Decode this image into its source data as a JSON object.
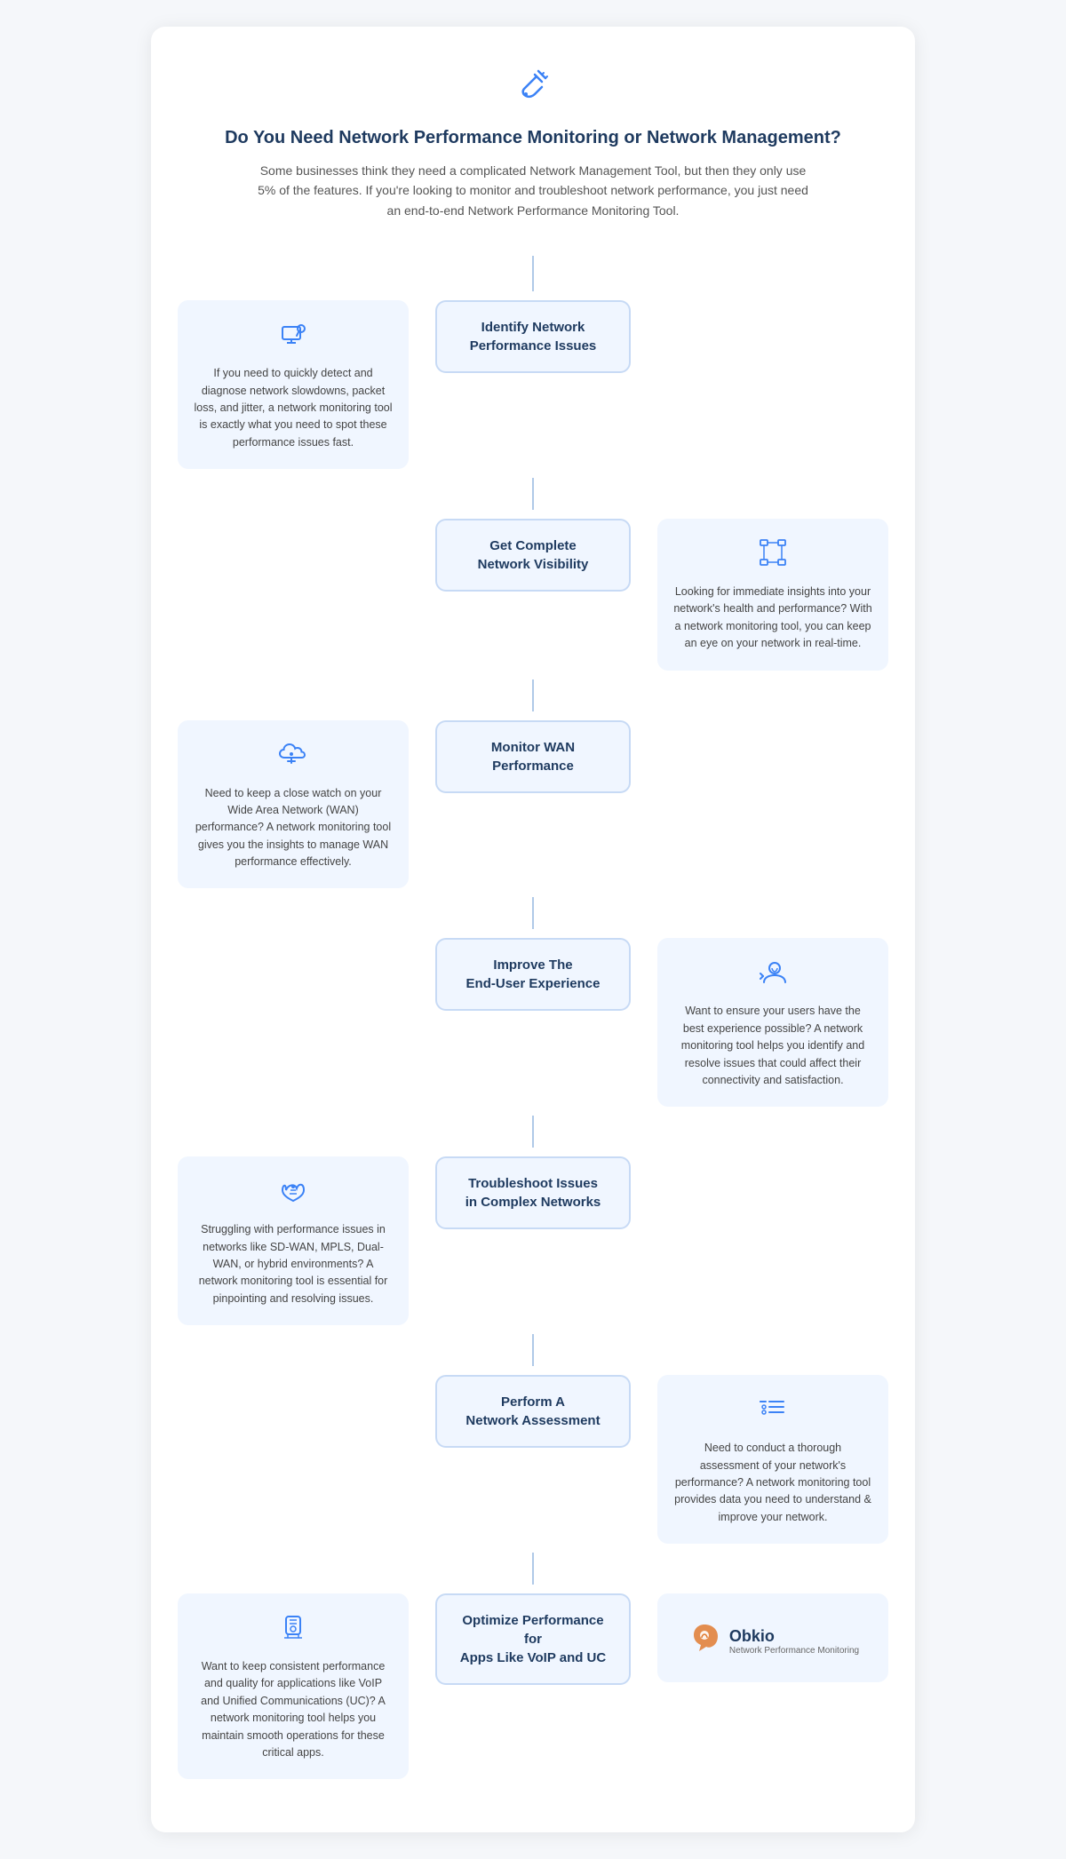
{
  "page": {
    "header": {
      "icon_label": "network-plugin-icon",
      "title": "Do You Need Network Performance Monitoring or Network Management?",
      "description": "Some businesses think they need a complicated Network Management Tool, but then they only use 5% of the features. If you're looking to monitor and troubleshoot network performance, you just need an end-to-end Network Performance Monitoring Tool."
    },
    "rows": [
      {
        "id": "row1",
        "left": {
          "visible": true,
          "icon": "person-monitor",
          "text": "If you need to quickly detect and diagnose network slowdowns, packet loss, and jitter, a network monitoring tool is exactly what you need to spot these performance issues fast."
        },
        "center": {
          "label": "Identify Network\nPerformance Issues"
        },
        "right": {
          "visible": false,
          "icon": "",
          "text": ""
        }
      },
      {
        "id": "row2",
        "left": {
          "visible": false,
          "icon": "",
          "text": ""
        },
        "center": {
          "label": "Get Complete\nNetwork Visibility"
        },
        "right": {
          "visible": true,
          "icon": "network-diagram",
          "text": "Looking for immediate insights into your network's health and performance? With a network monitoring tool, you can keep an eye on your network in real-time."
        }
      },
      {
        "id": "row3",
        "left": {
          "visible": true,
          "icon": "cloud-monitor",
          "text": "Need to keep a close watch on your Wide Area Network (WAN) performance? A network monitoring tool gives you the insights to manage WAN performance effectively."
        },
        "center": {
          "label": "Monitor WAN\nPerformance"
        },
        "right": {
          "visible": false,
          "icon": "",
          "text": ""
        }
      },
      {
        "id": "row4",
        "left": {
          "visible": false,
          "icon": "",
          "text": ""
        },
        "center": {
          "label": "Improve The\nEnd-User Experience"
        },
        "right": {
          "visible": true,
          "icon": "user-satisfaction",
          "text": "Want to ensure your users have the best experience possible? A network monitoring tool helps you identify and resolve issues that could affect their connectivity and satisfaction."
        }
      },
      {
        "id": "row5",
        "left": {
          "visible": true,
          "icon": "complex-network",
          "text": "Struggling with performance issues in networks like SD-WAN, MPLS, Dual-WAN, or hybrid environments? A network monitoring tool is essential for pinpointing and resolving issues."
        },
        "center": {
          "label": "Troubleshoot Issues\nin Complex Networks"
        },
        "right": {
          "visible": false,
          "icon": "",
          "text": ""
        }
      },
      {
        "id": "row6",
        "left": {
          "visible": false,
          "icon": "",
          "text": ""
        },
        "center": {
          "label": "Perform A\nNetwork Assessment"
        },
        "right": {
          "visible": true,
          "icon": "assessment-list",
          "text": "Need to conduct a thorough assessment of your network's performance? A network monitoring tool provides data you need to understand & improve your network."
        }
      },
      {
        "id": "row7",
        "left": {
          "visible": true,
          "icon": "voip-settings",
          "text": "Want to keep consistent performance and quality for applications like VoIP and Unified Communications (UC)? A network monitoring tool helps you maintain smooth operations for these critical apps."
        },
        "center": {
          "label": "Optimize Performance for\nApps Like VoIP and UC"
        },
        "right": {
          "visible": true,
          "icon": "obkio-logo",
          "text": ""
        }
      }
    ]
  }
}
